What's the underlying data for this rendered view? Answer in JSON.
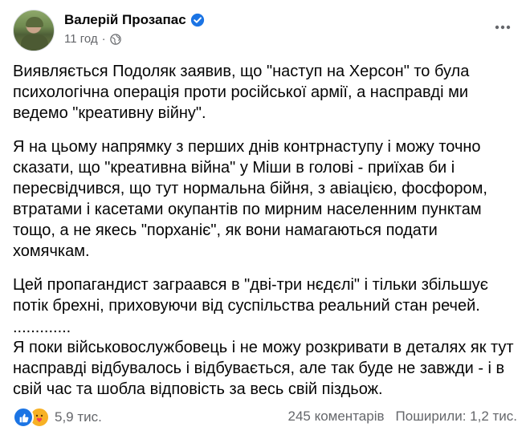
{
  "post": {
    "author": "Валерій Прозапас",
    "time": "11 год",
    "separator": "·",
    "paragraphs": [
      "Виявляється Подоляк заявив, що \"наступ на Херсон\" то була психологічна операція проти російської армії, а насправді ми ведемо \"креативну війну\".",
      "Я на цьому напрямку з перших днів контрнаступу і можу точно сказати, що \"креативна війна\" у Міши в голові - приїхав би і пересвідчився, що тут нормальна бійня, з авіацією, фосфором, втратами і касетами окупантів по мирним населенним пунктам тощо, а не якесь \"порханіє\", як вони намагаються подати хомячкам.",
      "Цей пропагандист заграався в \"дві-три нєдєлі\" і тільки збільшує потік брехні, приховуючи від суспільства реальний стан речей.",
      ".............",
      "Я поки військовослужбовець і не можу розкривати в деталях як тут насправді відбувалось і відбувається, але так буде не завжди - і в свій час та шобла відповість за весь свій піздьож."
    ]
  },
  "footer": {
    "reactions_count": "5,9 тис.",
    "comments": "245 коментарів",
    "shares": "Поширили: 1,2 тис."
  },
  "colors": {
    "primary_text": "#050505",
    "secondary_text": "#65676b",
    "accent": "#1b74e4",
    "care_reaction": "#f7b125"
  },
  "icons": [
    "verified-badge-icon",
    "globe-icon",
    "more-options-icon",
    "like-reaction-icon",
    "care-reaction-icon"
  ]
}
